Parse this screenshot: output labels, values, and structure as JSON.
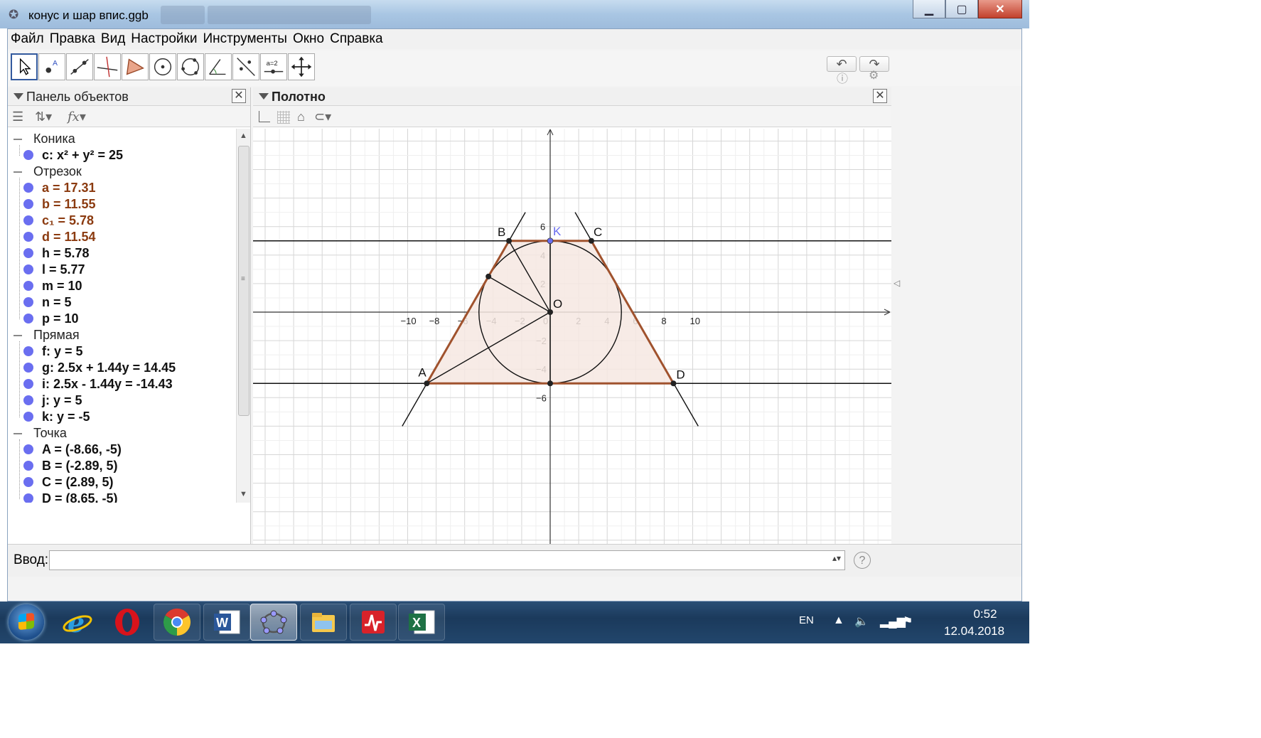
{
  "window": {
    "title": "конус и шар впис.ggb",
    "icon": "geogebra-icon",
    "controls": [
      "minimize-icon",
      "maximize-icon",
      "close-icon"
    ]
  },
  "menu": [
    "Файл",
    "Правка",
    "Вид",
    "Настройки",
    "Инструменты",
    "Окно",
    "Справка"
  ],
  "toolbar": {
    "tools": [
      "move-tool-icon",
      "point-tool-icon",
      "line-tool-icon",
      "perpendicular-tool-icon",
      "polygon-tool-icon",
      "circle-center-tool-icon",
      "circle-three-points-tool-icon",
      "angle-tool-icon",
      "reflect-tool-icon",
      "slider-tool-icon",
      "move-view-tool-icon"
    ],
    "slider_label": "a=2",
    "right": [
      "undo-icon",
      "redo-icon",
      "help-icon",
      "settings-icon"
    ]
  },
  "algebra": {
    "title": "Панель объектов",
    "categories": [
      {
        "name": "Коника",
        "items": [
          {
            "text": "c: x² + y² = 25",
            "brown": false
          }
        ]
      },
      {
        "name": "Отрезок",
        "items": [
          {
            "text": "a = 17.31",
            "brown": true
          },
          {
            "text": "b = 11.55",
            "brown": true
          },
          {
            "text": "c₁ = 5.78",
            "brown": true
          },
          {
            "text": "d = 11.54",
            "brown": true
          },
          {
            "text": "h = 5.78",
            "brown": false
          },
          {
            "text": "l = 5.77",
            "brown": false
          },
          {
            "text": "m = 10",
            "brown": false
          },
          {
            "text": "n = 5",
            "brown": false
          },
          {
            "text": "p = 10",
            "brown": false
          }
        ]
      },
      {
        "name": "Прямая",
        "items": [
          {
            "text": "f: y = 5",
            "brown": false
          },
          {
            "text": "g: 2.5x + 1.44y = 14.45",
            "brown": false
          },
          {
            "text": "i: 2.5x - 1.44y = -14.43",
            "brown": false
          },
          {
            "text": "j: y = 5",
            "brown": false
          },
          {
            "text": "k: y = -5",
            "brown": false
          }
        ]
      },
      {
        "name": "Точка",
        "items": [
          {
            "text": "A = (-8.66, -5)",
            "brown": false
          },
          {
            "text": "B = (-2.89, 5)",
            "brown": false
          },
          {
            "text": "C = (2.89, 5)",
            "brown": false
          },
          {
            "text": "D = (8.65, -5)",
            "brown": false
          }
        ]
      }
    ]
  },
  "graphics": {
    "title": "Полотно",
    "x_ticks": [
      "−10",
      "−8",
      "−6",
      "−4",
      "−2",
      "0",
      "2",
      "4",
      "6",
      "8",
      "10"
    ],
    "y_ticks": [
      "6",
      "4",
      "2",
      "−2",
      "−4",
      "−6"
    ],
    "point_labels": {
      "A": "A",
      "B": "B",
      "C": "C",
      "D": "D",
      "K": "K",
      "O": "O"
    },
    "colors": {
      "trapezoid": "#a0522d",
      "fill": "#f6e8e2",
      "grid": "#e0e0e0",
      "point_K": "#6a6ef0"
    }
  },
  "input": {
    "label": "Ввод:",
    "value": "",
    "placeholder": ""
  },
  "taskbar": {
    "apps": [
      "internet-explorer-icon",
      "opera-icon",
      "chrome-icon",
      "word-icon",
      "geogebra-icon",
      "file-explorer-icon",
      "pdf-viewer-icon",
      "excel-icon"
    ],
    "lang": "EN",
    "time": "0:52",
    "date": "12.04.2018"
  }
}
